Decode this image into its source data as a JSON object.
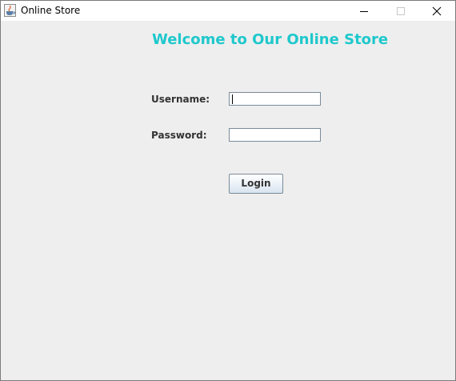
{
  "window": {
    "title": "Online Store",
    "icon": "java-cup-icon",
    "controls": [
      "minimize-icon",
      "maximize-icon",
      "close-icon"
    ]
  },
  "main": {
    "welcome_text": "Welcome to Our Online Store",
    "username_label": "Username:",
    "username_value": "",
    "password_label": "Password:",
    "password_value": "",
    "login_label": "Login"
  },
  "colors": {
    "welcome": "#1ec8cc",
    "background": "#eeeeee",
    "label": "#333333"
  }
}
